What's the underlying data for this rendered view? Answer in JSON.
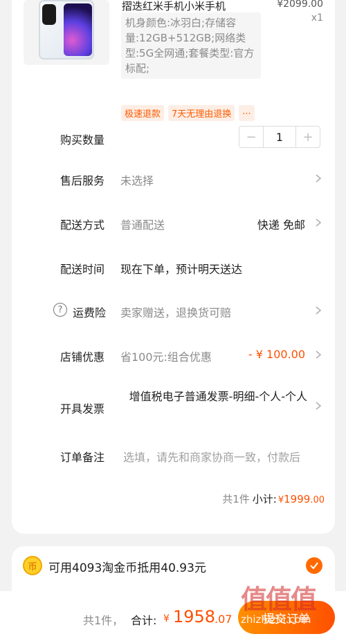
{
  "product": {
    "title": "摺迭红米手机小米手机",
    "price": "¥2099.00",
    "quantity": "x1",
    "spec": "机身颜色:冰羽白;存储容量:12GB+512GB;网络类型:5G全网通;套餐类型:官方标配;",
    "tags": [
      "极速退款",
      "7天无理由退换",
      "..."
    ]
  },
  "rows": {
    "quantity": {
      "label": "购买数量",
      "minus": "−",
      "value": "1",
      "plus": "+"
    },
    "after_sale": {
      "label": "售后服务",
      "value": "未选择"
    },
    "delivery": {
      "label": "配送方式",
      "value": "普通配送",
      "right": "快递 免邮"
    },
    "delivery_time": {
      "label": "配送时间",
      "value": "现在下单，预计明天送达"
    },
    "freight_insurance": {
      "label": "运费险",
      "value": "卖家赠送，退换货可赔",
      "icon": "?"
    },
    "shop_discount": {
      "label": "店铺优惠",
      "value": "省100元:组合优惠",
      "right": "- ¥ 100.00"
    },
    "invoice": {
      "label": "开具发票",
      "value": "增值税电子普通发票-明细-个人-个人"
    },
    "note": {
      "label": "订单备注",
      "placeholder": "选填，请先和商家协商一致，付款后"
    }
  },
  "subtotal": {
    "count": "共1件",
    "label": "小计:",
    "yen": "¥",
    "big": "1999",
    "small": ".00"
  },
  "coin": {
    "icon": "币",
    "text": "可用4093淘金币抵用40.93元"
  },
  "bottom": {
    "count": "共1件，",
    "label": "合计:",
    "yen": "¥",
    "big": "1958",
    "small": ".07",
    "submit": "提交订单"
  },
  "watermark": {
    "logo": "值值值",
    "url": "zhizhizhi.com"
  },
  "colors": {
    "accent": "#ff5000",
    "tag_bg": "#fdeee5",
    "page_bg": "#f2f2f2"
  }
}
